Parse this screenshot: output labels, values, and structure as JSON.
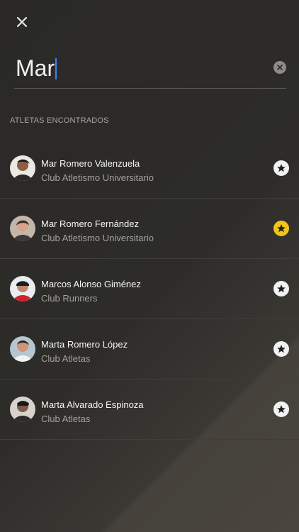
{
  "search": {
    "value": "Mar"
  },
  "section_title": "ATLETAS ENCONTRADOS",
  "colors": {
    "accent": "#3b82f6",
    "favorite": "#f2c417",
    "text": "#f5f5f5",
    "muted": "#a3a29d"
  },
  "icons": {
    "close": "close-icon",
    "clear": "clear-icon",
    "favorite": "star-icon"
  },
  "athletes": [
    {
      "name": "Mar Romero Valenzuela",
      "club": "Club Atletismo Universitario",
      "favorite": false
    },
    {
      "name": "Mar Romero Fernández",
      "club": "Club Atletismo Universitario",
      "favorite": true
    },
    {
      "name": "Marcos Alonso Giménez",
      "club": "Club Runners",
      "favorite": false
    },
    {
      "name": "Marta Romero López",
      "club": "Club Atletas",
      "favorite": false
    },
    {
      "name": "Marta Alvarado Espinoza",
      "club": "Club Atletas",
      "favorite": false
    }
  ]
}
